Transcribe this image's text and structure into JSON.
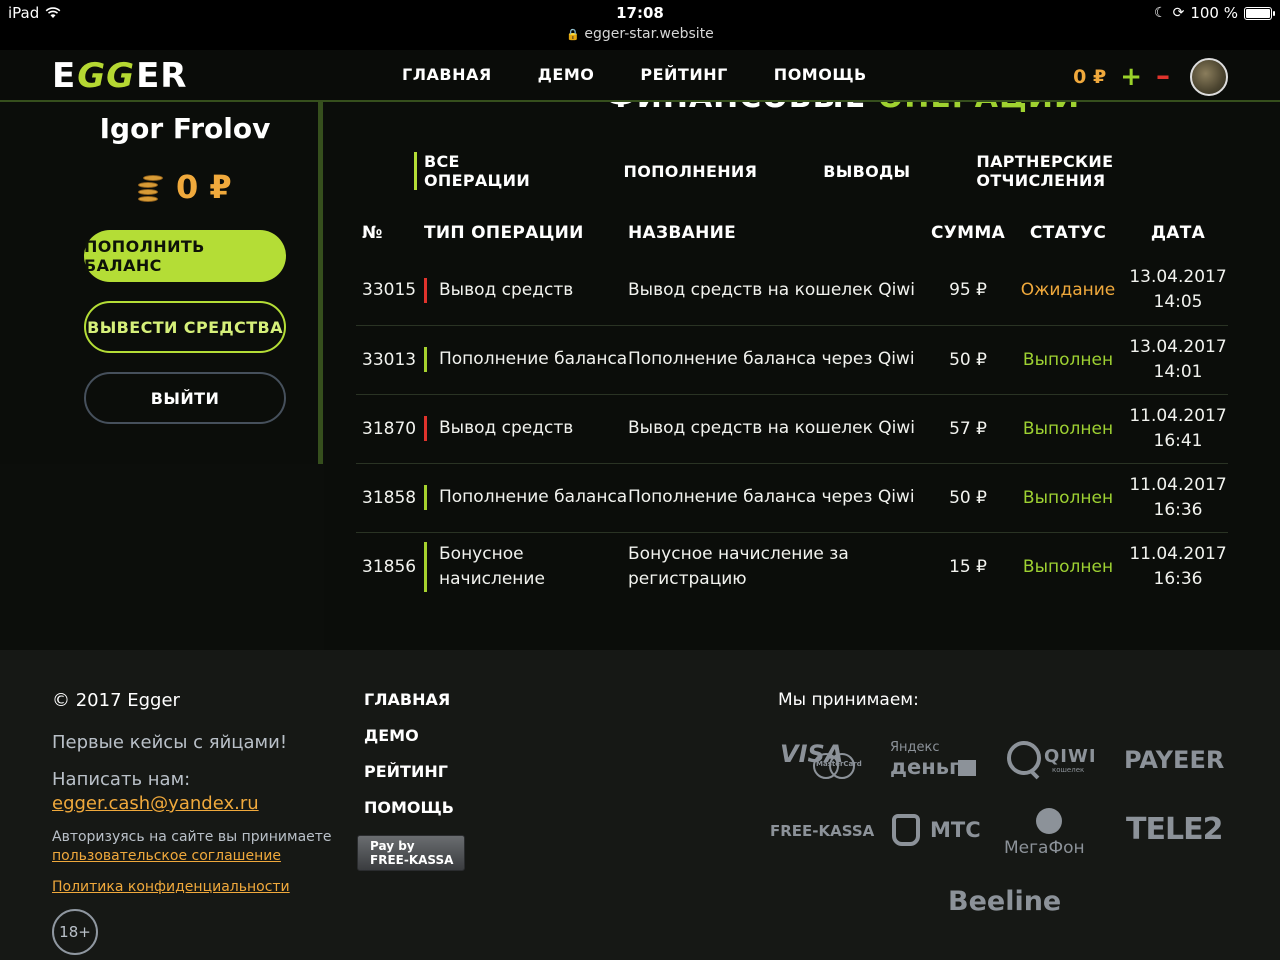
{
  "statusbar": {
    "device": "iPad",
    "time": "17:08",
    "url": "egger-star.website",
    "battery": "100 %"
  },
  "header": {
    "logo_left": "E",
    "logo_mid": "GG",
    "logo_right": "ER",
    "nav": [
      "ГЛАВНАЯ",
      "ДЕМО",
      "РЕЙТИНГ",
      "ПОМОЩЬ"
    ],
    "balance": "0 ₽",
    "plus": "+",
    "minus": "–"
  },
  "sidebar": {
    "username": "Igor Frolov",
    "balance": "0 ₽",
    "topup_label": "ПОПОЛНИТЬ БАЛАНС",
    "withdraw_label": "ВЫВЕСТИ СРЕДСТВА",
    "logout_label": "ВЫЙТИ"
  },
  "main": {
    "title_white": "ФИНАНСОВЫЕ ",
    "title_accent": "ОПЕРАЦИИ",
    "tabs": [
      "ВСЕ ОПЕРАЦИИ",
      "ПОПОЛНЕНИЯ",
      "ВЫВОДЫ",
      "ПАРТНЕРСКИЕ ОТЧИСЛЕНИЯ"
    ],
    "columns": [
      "№",
      "ТИП ОПЕРАЦИИ",
      "НАЗВАНИЕ",
      "СУММА",
      "СТАТУС",
      "ДАТА"
    ],
    "rows": [
      {
        "num": "33015",
        "type": "Вывод средств",
        "name": "Вывод средств на кошелек Qiwi",
        "sum": "95 ₽",
        "status": "Ожидание",
        "date": "13.04.2017",
        "time": "14:05"
      },
      {
        "num": "33013",
        "type": "Пополнение баланса",
        "name": "Пополнение баланса через Qiwi",
        "sum": "50 ₽",
        "status": "Выполнен",
        "date": "13.04.2017",
        "time": "14:01"
      },
      {
        "num": "31870",
        "type": "Вывод средств",
        "name": "Вывод средств на кошелек Qiwi",
        "sum": "57 ₽",
        "status": "Выполнен",
        "date": "11.04.2017",
        "time": "16:41"
      },
      {
        "num": "31858",
        "type": "Пополнение баланса",
        "name": "Пополнение баланса через Qiwi",
        "sum": "50 ₽",
        "status": "Выполнен",
        "date": "11.04.2017",
        "time": "16:36"
      },
      {
        "num": "31856",
        "type": "Бонусное начисление",
        "name": "Бонусное начисление за регистрацию",
        "sum": "15 ₽",
        "status": "Выполнен",
        "date": "11.04.2017",
        "time": "16:36"
      }
    ]
  },
  "footer": {
    "copyright": "© 2017 Egger",
    "tagline": "Первые кейсы с яйцами!",
    "write_us": "Написать нам:",
    "email": "egger.cash@yandex.ru",
    "agree_text": "Авторизуясь на сайте вы принимаете",
    "agree_link": "пользовательское соглашение",
    "privacy": "Политика конфиденциальности",
    "age": "18+",
    "nav": [
      "ГЛАВНАЯ",
      "ДЕМО",
      "РЕЙТИНГ",
      "ПОМОЩЬ"
    ],
    "fk_line1": "Pay by",
    "fk_line2": "FREE-KASSA",
    "accept": "Мы принимаем:",
    "payments": {
      "visa": "VISA",
      "mastercard": "MasterCard",
      "yandex1": "Яндекс",
      "yandex2": "деньги",
      "qiwi": "QIWI",
      "qiwi_sub": "кошелек",
      "payeer": "PAYEER",
      "freekassa": "FREE-KASSA",
      "mts": "МТС",
      "megafon": "МегаФон",
      "tele2": "TELE2",
      "beeline": "Beeline"
    }
  },
  "colors": {
    "accent_green": "#b4dd36",
    "accent_orange": "#f0a93c",
    "danger_red": "#e0332c"
  }
}
